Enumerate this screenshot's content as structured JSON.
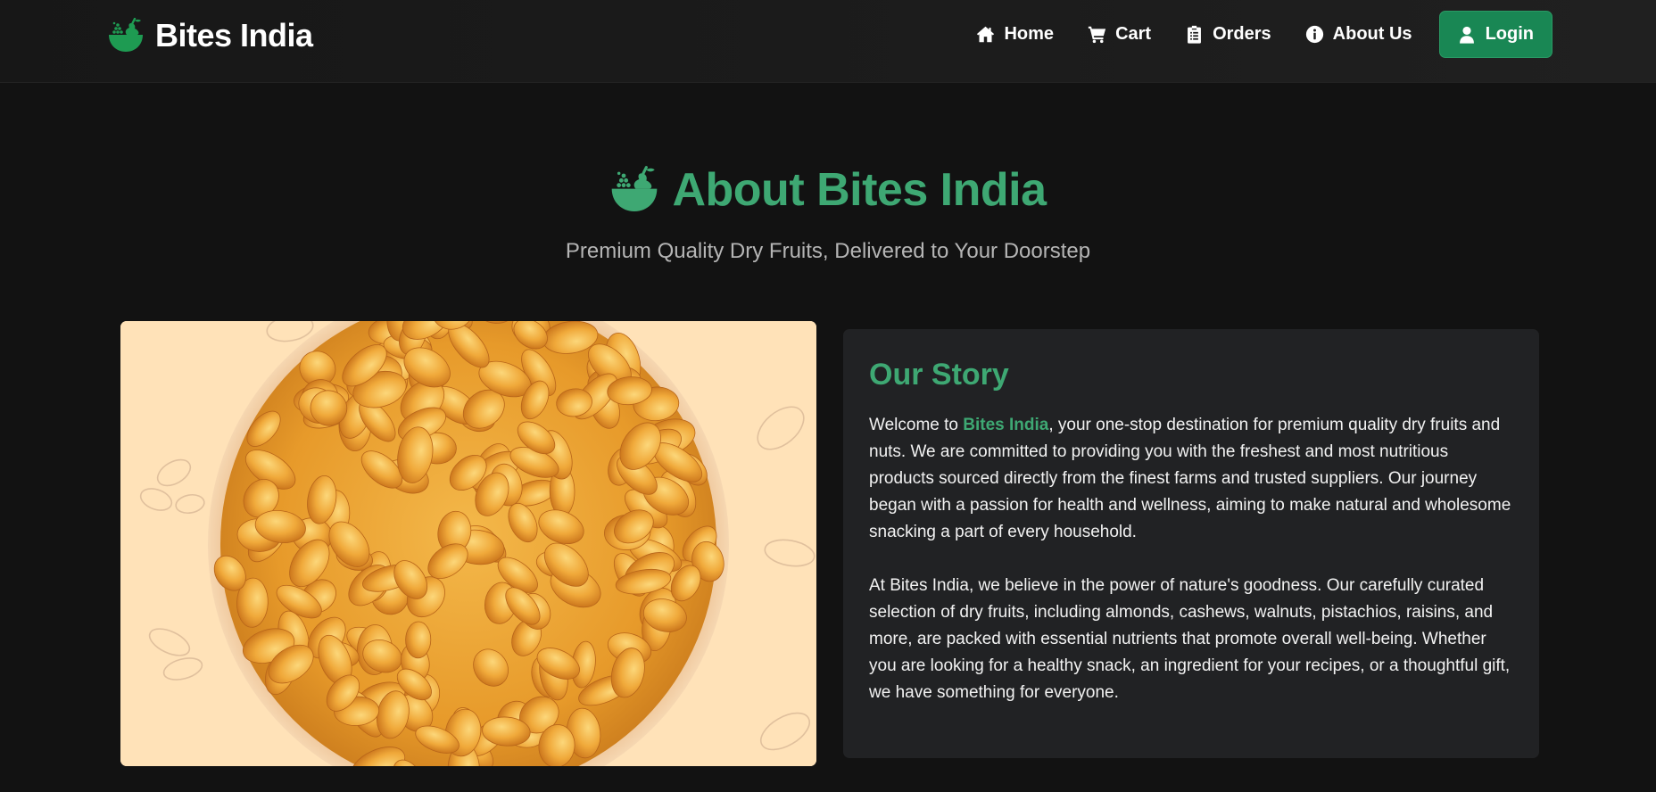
{
  "brand": {
    "name": "Bites India",
    "logo_icon": "fruit-basket-icon"
  },
  "nav": {
    "items": [
      {
        "label": "Home",
        "icon": "home-icon"
      },
      {
        "label": "Cart",
        "icon": "cart-icon"
      },
      {
        "label": "Orders",
        "icon": "clipboard-icon"
      },
      {
        "label": "About Us",
        "icon": "info-circle-icon"
      }
    ],
    "login": {
      "label": "Login",
      "icon": "user-icon"
    }
  },
  "hero": {
    "title": "About Bites India",
    "subtitle": "Premium Quality Dry Fruits, Delivered to Your Doorstep",
    "icon": "fruit-basket-icon"
  },
  "image": {
    "subject": "raisins-bowl"
  },
  "story": {
    "heading": "Our Story",
    "p1_prefix": "Welcome to ",
    "p1_highlight": "Bites India",
    "p1_suffix": ", your one-stop destination for premium quality dry fruits and nuts. We are committed to providing you with the freshest and most nutritious products sourced directly from the finest farms and trusted suppliers. Our journey began with a passion for health and wellness, aiming to make natural and wholesome snacking a part of every household.",
    "p2": "At Bites India, we believe in the power of nature's goodness. Our carefully curated selection of dry fruits, including almonds, cashews, walnuts, pistachios, raisins, and more, are packed with essential nutrients that promote overall well-being. Whether you are looking for a healthy snack, an ingredient for your recipes, or a thoughtful gift, we have something for everyone."
  },
  "colors": {
    "accent": "#3ea873",
    "button": "#198754",
    "background": "#121212",
    "card": "#212224",
    "image_bg": "#ffe2b8"
  }
}
